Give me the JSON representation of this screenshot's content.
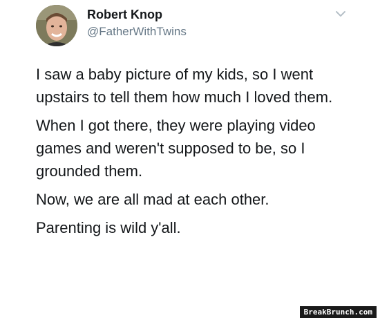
{
  "tweet": {
    "display_name": "Robert Knop",
    "handle": "@FatherWithTwins",
    "paragraphs": [
      "I saw a baby picture of my kids, so I went upstairs to tell them how much I loved them.",
      "When I got there, they were playing video games and weren't supposed to be, so I grounded them.",
      "Now, we are all mad at each other.",
      "Parenting is wild y'all."
    ],
    "menu_icon": "chevron-down-icon",
    "avatar_icon": "avatar"
  },
  "watermark": {
    "text": "BreakBrunch.com"
  },
  "colors": {
    "text": "#14171a",
    "secondary": "#657786",
    "chevron": "#b6c0c8"
  }
}
